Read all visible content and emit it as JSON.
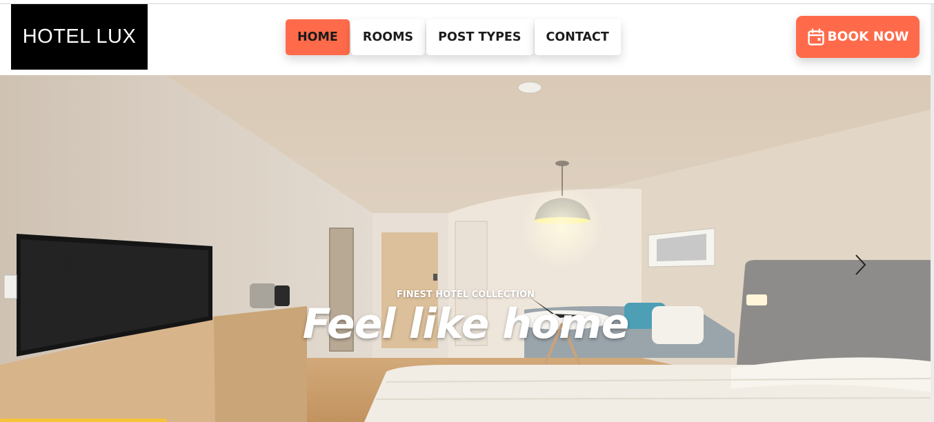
{
  "brand": {
    "name": "HOTEL LUX"
  },
  "nav": {
    "items": [
      {
        "label": "HOME",
        "active": true
      },
      {
        "label": "ROOMS",
        "active": false
      },
      {
        "label": "POST TYPES",
        "active": false
      },
      {
        "label": "CONTACT",
        "active": false
      }
    ]
  },
  "book_button": {
    "label": "BOOK NOW",
    "icon": "calendar-icon"
  },
  "hero": {
    "subtitle": "FINEST HOTEL COLLECTION",
    "title": "Feel like home",
    "prev_icon": "chevron-left-icon",
    "next_icon": "chevron-right-icon"
  },
  "colors": {
    "accent": "#ff6b4a",
    "logo_bg": "#000000",
    "text_dark": "#1c1c1c"
  }
}
